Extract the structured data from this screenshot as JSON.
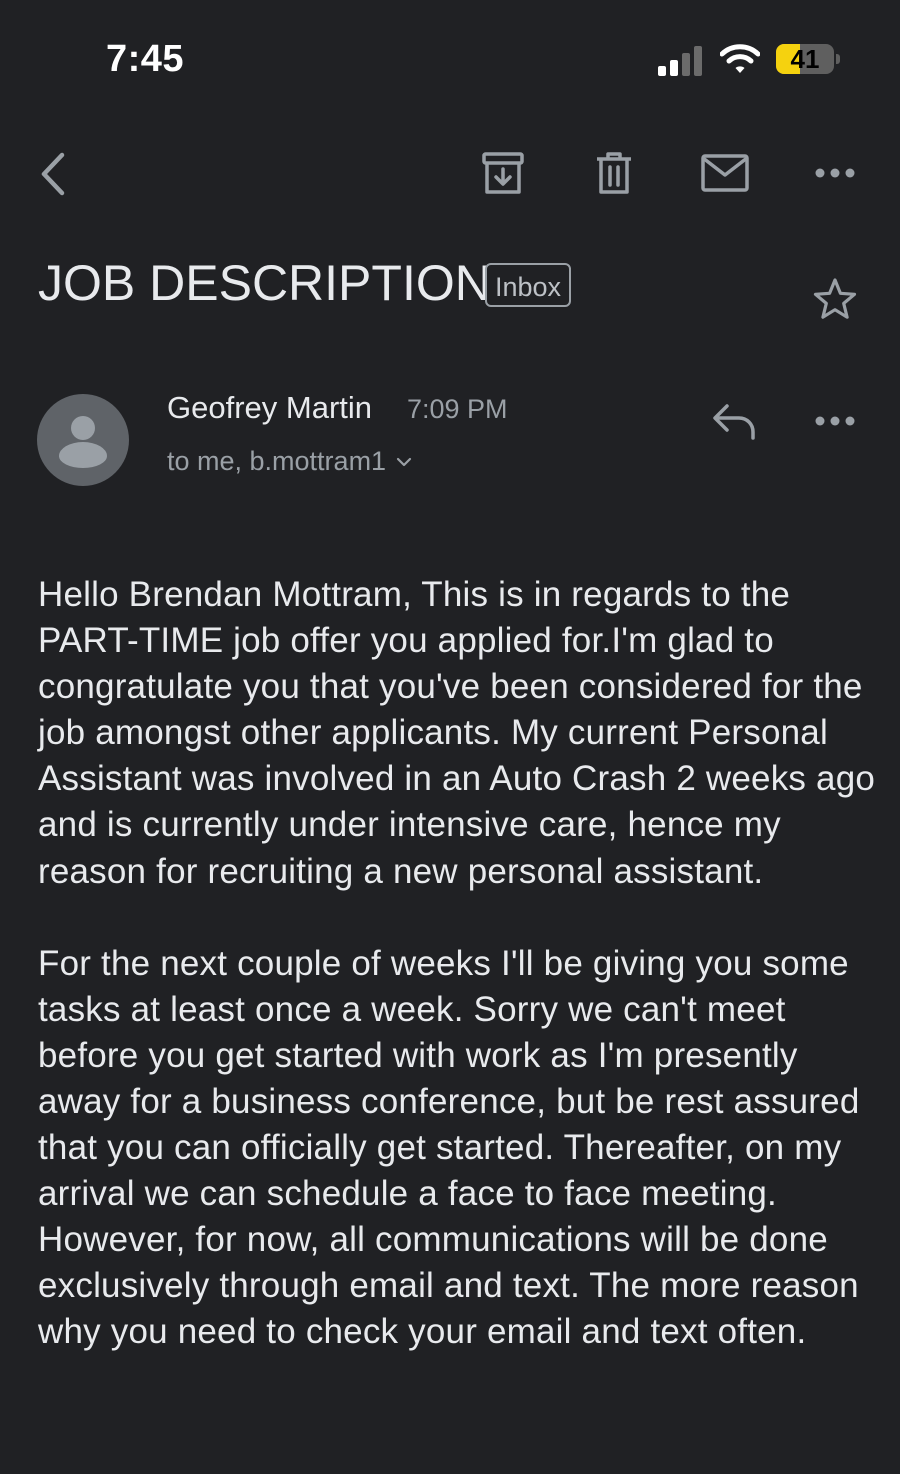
{
  "status_bar": {
    "time": "7:45",
    "battery_level": "41"
  },
  "toolbar": {
    "back_icon": "chevron-left-icon",
    "archive_icon": "archive-icon",
    "delete_icon": "trash-icon",
    "mark_unread_icon": "mail-icon",
    "more_icon": "more-horizontal-icon"
  },
  "email": {
    "subject": "JOB DESCRIPTION",
    "label": "Inbox",
    "sender_name": "Geofrey Martin",
    "sent_time": "7:09 PM",
    "recipients": "to me, b.mottram1",
    "body_paragraphs": [
      "Hello Brendan Mottram, This is in regards to the PART-TIME job offer you applied for.I'm glad to congratulate you that you've been considered for the job amongst other applicants. My current Personal Assistant was involved in an Auto Crash 2 weeks ago and is currently under intensive care, hence my reason for recruiting a new personal assistant.",
      "For the next couple of weeks I'll be giving you some tasks at least once a week. Sorry we can't meet before you get started with work as I'm presently away for a business conference, but be rest assured that you can officially get started. Thereafter, on my arrival we can schedule a face to face meeting. However, for now, all communications will be done exclusively through email and text. The more reason why you need to check your email and text often."
    ]
  },
  "colors": {
    "background": "#202124",
    "text_primary": "#e8eaed",
    "text_secondary": "#9aa0a6",
    "battery": "#f5d20f"
  }
}
